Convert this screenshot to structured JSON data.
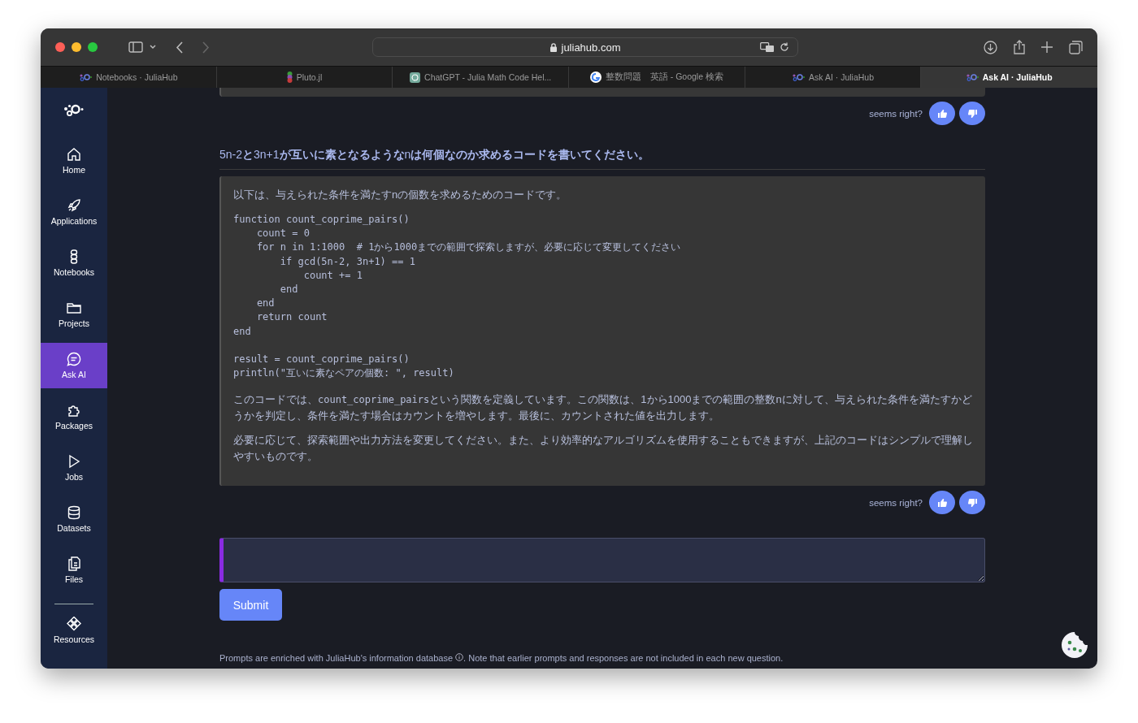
{
  "browser": {
    "url": "juliahub.com"
  },
  "tabs": [
    {
      "title": "Notebooks · JuliaHub",
      "kind": "julia",
      "selected": false
    },
    {
      "title": "Pluto.jl",
      "kind": "pluto",
      "selected": false
    },
    {
      "title": "ChatGPT - Julia Math Code Hel...",
      "kind": "chatgpt",
      "selected": false
    },
    {
      "title": "整数問題　英語 - Google 検索",
      "kind": "google",
      "selected": false
    },
    {
      "title": "Ask AI · JuliaHub",
      "kind": "julia",
      "selected": false
    },
    {
      "title": "Ask AI · JuliaHub",
      "kind": "julia",
      "selected": true
    }
  ],
  "sidebar": {
    "items": [
      {
        "label": "Home",
        "kind": "home",
        "selected": false
      },
      {
        "label": "Applications",
        "kind": "rocket",
        "selected": false
      },
      {
        "label": "Notebooks",
        "kind": "notebook",
        "selected": false
      },
      {
        "label": "Projects",
        "kind": "folder",
        "selected": false
      },
      {
        "label": "Ask AI",
        "kind": "chat",
        "selected": true
      },
      {
        "label": "Packages",
        "kind": "puzzle",
        "selected": false
      },
      {
        "label": "Jobs",
        "kind": "play",
        "selected": false
      },
      {
        "label": "Datasets",
        "kind": "database",
        "selected": false
      },
      {
        "label": "Files",
        "kind": "files",
        "selected": false
      },
      {
        "label": "Resources",
        "kind": "resources",
        "selected": false
      }
    ]
  },
  "feedback_prompt_top": "seems right?",
  "question": "5n-2**と**3n+1**が互いに素となるような**n**は何個なのか求めるコードを書いてください。**",
  "answer": {
    "intro": "以下は、与えられた条件を満たすnの個数を求めるためのコードです。",
    "code_blocks": [
      [
        "function count_coprime_pairs()",
        "    count = 0",
        "    for n in 1:1000  # 1から1000までの範囲で探索しますが、必要に応じて変更してください",
        "        if gcd(5n-2, 3n+1) == 1",
        "            count += 1",
        "        end",
        "    end",
        "    return count",
        "end"
      ],
      [
        "result = count_coprime_pairs()",
        "println(\"互いに素なペアの個数: \", result)"
      ]
    ],
    "paragraphs": [
      [
        {
          "kind": "text",
          "text": "このコードでは、"
        },
        {
          "kind": "code",
          "text": "count_coprime_pairs"
        },
        {
          "kind": "text",
          "text": "という関数を定義しています。この関数は、1から1000までの範囲の整数nに対して、与えられた条件を満たすかどうかを判定し、条件を満たす場合はカウントを増やします。最後に、カウントされた値を出力します。"
        }
      ],
      [
        {
          "kind": "text",
          "text": "必要に応じて、探索範囲や出力方法を変更してください。また、より効率的なアルゴリズムを使用することもできますが、上記のコードはシンプルで理解しやすいものです。"
        }
      ]
    ]
  },
  "feedback_prompt_bottom": "seems right?",
  "submit": "Submit",
  "footer": {
    "before": "Prompts are enriched with JuliaHub's information database",
    "after": ". Note that earlier prompts and responses are not included in each new question."
  }
}
